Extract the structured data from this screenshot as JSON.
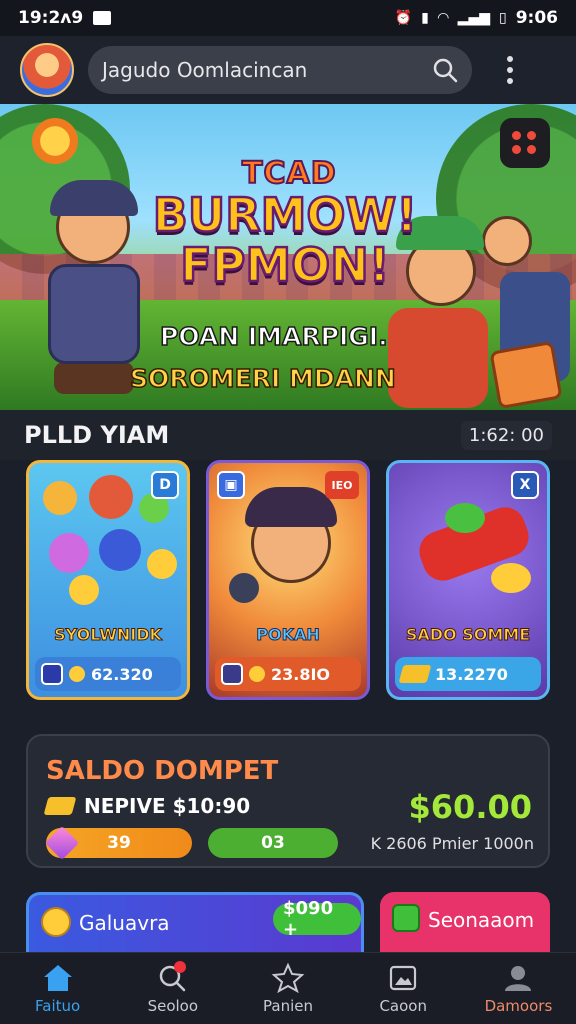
{
  "status_bar": {
    "time": "19:2ʌ9",
    "right_time": "9:06"
  },
  "top_bar": {
    "search_placeholder": "Jagudo Oomlacincan"
  },
  "banner": {
    "title_top": "TCAD",
    "title_line1": "BURMOW!",
    "title_line2": "FPMON!",
    "subtitle1": "POAN IMARPIGI.",
    "subtitle2": "SOROMERI MDANN"
  },
  "section": {
    "title": "PLLD YIAM",
    "timer": "1:62: 00"
  },
  "cards": [
    {
      "label": "SYOLWNIDK",
      "value": "62.320",
      "badge": "D"
    },
    {
      "label": "POKAH",
      "value": "23.8IO",
      "badge": "IEO"
    },
    {
      "label": "SADO SOMME",
      "value": "13.2270",
      "badge": "X"
    }
  ],
  "wallet": {
    "title": "SALDO DOMPET",
    "subtitle": "NEPIVE $10:90",
    "amount": "$60.00",
    "pill_orange": "39",
    "pill_green": "03",
    "note": "K 2606 Pmier 1000n"
  },
  "promos": [
    {
      "label": "Galuavra",
      "price": "$090 +"
    },
    {
      "label": "Seonaaom"
    }
  ],
  "bottom_nav": [
    {
      "label": "Faituo",
      "icon": "home-icon"
    },
    {
      "label": "Seoloo",
      "icon": "search-icon"
    },
    {
      "label": "Panien",
      "icon": "star-icon"
    },
    {
      "label": "Caoon",
      "icon": "gallery-icon"
    },
    {
      "label": "Damoors",
      "icon": "profile-icon"
    }
  ],
  "colors": {
    "accent_blue": "#3aa0f0",
    "money_green": "#a4e83a",
    "wallet_title": "#ff8a4a"
  }
}
